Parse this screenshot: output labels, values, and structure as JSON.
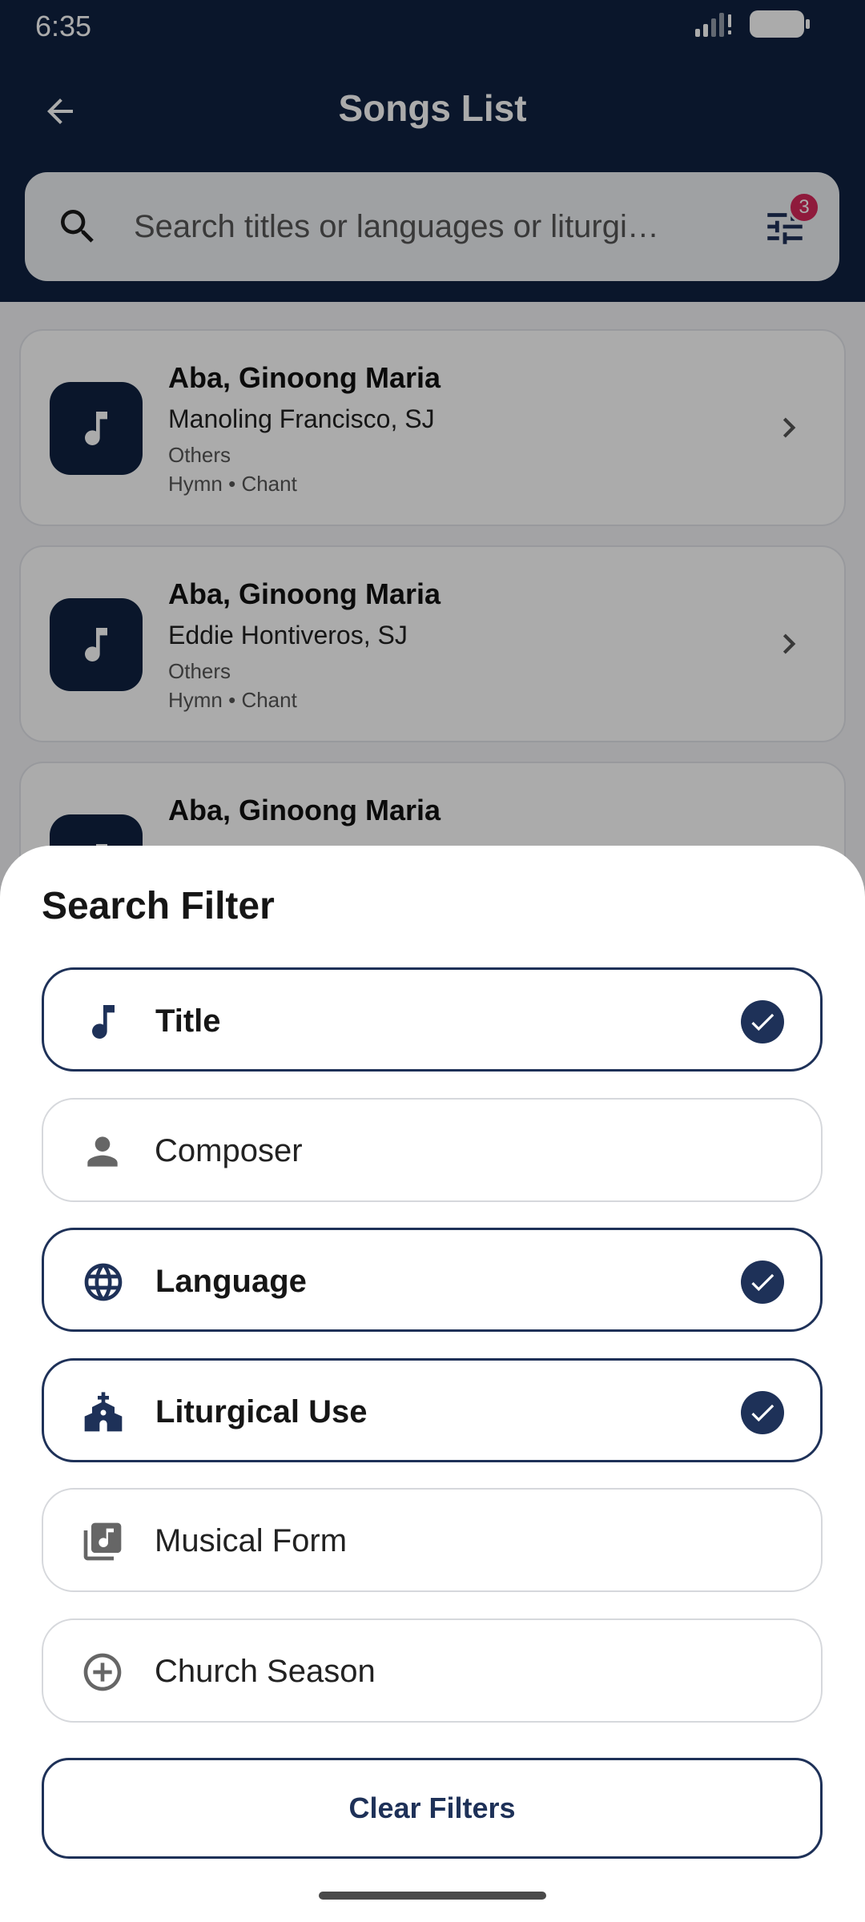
{
  "status_bar": {
    "time": "6:35"
  },
  "app_bar": {
    "title": "Songs List"
  },
  "search": {
    "placeholder": "Search titles or languages or liturgi…",
    "filter_count": "3"
  },
  "songs": [
    {
      "title": "Aba, Ginoong Maria",
      "composer": "Manoling Francisco, SJ",
      "category": "Others",
      "tags": "Hymn • Chant"
    },
    {
      "title": "Aba, Ginoong Maria",
      "composer": "Eddie Hontiveros, SJ",
      "category": "Others",
      "tags": "Hymn • Chant"
    },
    {
      "title": "Aba, Ginoong Maria",
      "composer": "",
      "category": "",
      "tags": ""
    }
  ],
  "filter_sheet": {
    "title": "Search Filter",
    "options": [
      {
        "label": "Title",
        "icon": "music-note-icon",
        "selected": true
      },
      {
        "label": "Composer",
        "icon": "person-icon",
        "selected": false
      },
      {
        "label": "Language",
        "icon": "globe-icon",
        "selected": true
      },
      {
        "label": "Liturgical Use",
        "icon": "church-icon",
        "selected": true
      },
      {
        "label": "Musical Form",
        "icon": "music-library-icon",
        "selected": false
      },
      {
        "label": "Church Season",
        "icon": "add-circle-icon",
        "selected": false
      }
    ],
    "clear_label": "Clear Filters"
  },
  "colors": {
    "primary": "#0f2240",
    "accent": "#1e3158",
    "badge": "#d5275a",
    "sheet": "#ffffff"
  }
}
